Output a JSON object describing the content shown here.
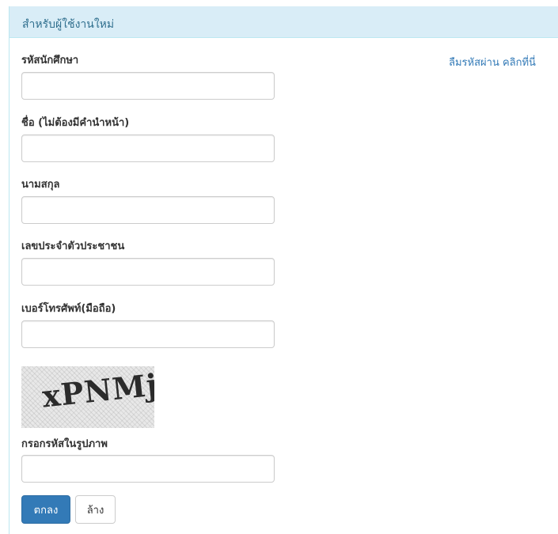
{
  "panel": {
    "title": "สำหรับผู้ใช้งานใหม่"
  },
  "forgot_password": {
    "label": "ลืมรหัสผ่าน คลิกที่นี่"
  },
  "form": {
    "fields": [
      {
        "label": "รหัสนักศึกษา",
        "value": "",
        "placeholder": ""
      },
      {
        "label": "ชื่อ (ไม่ต้องมีคำนำหน้า)",
        "value": "",
        "placeholder": ""
      },
      {
        "label": "นามสกุล",
        "value": "",
        "placeholder": ""
      },
      {
        "label": "เลขประจำตัวประชาชน",
        "value": "",
        "placeholder": ""
      },
      {
        "label": "เบอร์โทรศัพท์(มือถือ)",
        "value": "",
        "placeholder": ""
      }
    ],
    "captcha": {
      "image_text": "xPNMj",
      "label": "กรอกรหัสในรูปภาพ",
      "value": ""
    }
  },
  "buttons": {
    "submit_label": "ตกลง",
    "clear_label": "ล้าง"
  },
  "colors": {
    "heading_bg": "#d9edf7",
    "heading_text": "#31708f",
    "link": "#337ab7",
    "primary": "#337ab7"
  }
}
